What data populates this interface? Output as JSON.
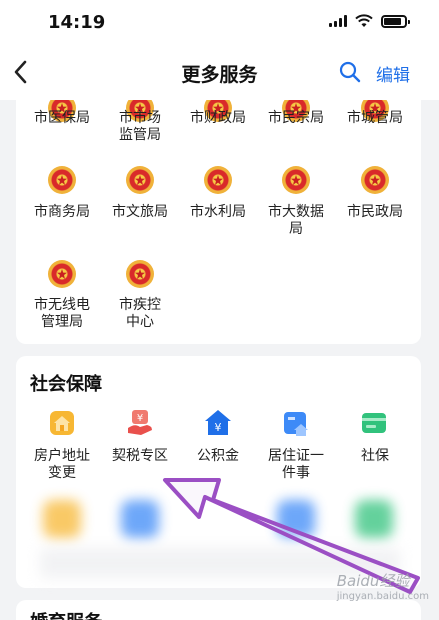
{
  "status": {
    "time": "14:19"
  },
  "nav": {
    "title": "更多服务",
    "edit": "编辑"
  },
  "gov_services": [
    {
      "label": "市医保局"
    },
    {
      "label": "市市场\n监管局"
    },
    {
      "label": "市财政局"
    },
    {
      "label": "市民宗局"
    },
    {
      "label": "市城管局"
    },
    {
      "label": "市商务局"
    },
    {
      "label": "市文旅局"
    },
    {
      "label": "市水利局"
    },
    {
      "label": "市大数据\n局"
    },
    {
      "label": "市民政局"
    },
    {
      "label": "市无线电\n管理局"
    },
    {
      "label": "市疾控\n中心"
    }
  ],
  "social": {
    "title": "社会保障",
    "items": [
      {
        "label": "房户地址\n变更",
        "icon": "house-icon",
        "color": "#f5a623"
      },
      {
        "label": "契税专区",
        "icon": "tax-icon",
        "color": "#e9504c"
      },
      {
        "label": "公积金",
        "icon": "fund-icon",
        "color": "#1f6fe8"
      },
      {
        "label": "居住证一\n件事",
        "icon": "residence-icon",
        "color": "#3d8af7"
      },
      {
        "label": "社保",
        "icon": "social-card-icon",
        "color": "#31c27c"
      }
    ]
  },
  "next_section": {
    "title": "婚育服务"
  },
  "watermark": {
    "brand": "Baidu经验",
    "url": "jingyan.baidu.com"
  },
  "colors": {
    "accent": "#1f6fe8",
    "annotation_arrow": "#9b4fc4"
  }
}
